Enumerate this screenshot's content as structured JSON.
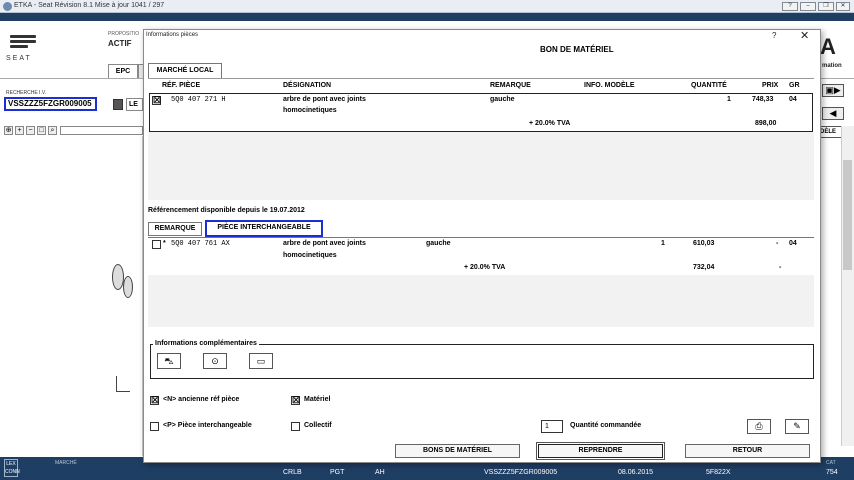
{
  "window": {
    "title": "ETKA - Seat Révision 8.1 Mise à jour 1041 / 297"
  },
  "app": {
    "brand": "SEAT",
    "proposition_label": "PROPOSITIO",
    "status_label": "ACTIF",
    "tab_epc": "EPC",
    "tab_le": "LE",
    "search_label": "RECHERCHE I.V.",
    "vin_value": "VSSZZZ5FZGR009005",
    "right_label_a": "A",
    "right_label_mation": "mation",
    "right_label_dele": "DÈLE"
  },
  "statusbar": {
    "lex_label": "LEX CONN",
    "marche_label": "MARCHÉ",
    "engine": "CRLB",
    "gear": "PGT",
    "ah": "AH",
    "vin": "VSSZZZ5FZGR009005",
    "date": "08.06.2015",
    "code": "5F822X",
    "cat_label": "CAT",
    "cat_value": "754"
  },
  "dialog": {
    "title": "Informations pièces",
    "help": "?",
    "close": "✕",
    "heading": "BON DE MATÉRIEL",
    "market_tab": "MARCHÉ LOCAL",
    "columns": {
      "ref": "RÉF. PIÈCE",
      "designation": "DÉSIGNATION",
      "remark": "REMARQUE",
      "model_info": "INFO. MODÈLE",
      "quantity": "QUANTITÉ",
      "price": "PRIX",
      "gr": "GR"
    },
    "main_part": {
      "checked": "☒",
      "ref": "5Q0 407 271 H",
      "designation_1": "arbre de pont avec joints",
      "designation_2": "homocinetiques",
      "remark": "gauche",
      "quantity": "1",
      "price": "748,33",
      "gr": "04",
      "tva_label": "+ 20.0% TVA",
      "price_tva": "898,00"
    },
    "reference_since": "Référencement disponible depuis le 19.07.2012",
    "sub_tabs": {
      "remark": "REMARQUE",
      "interchangeable": "PIÈCE INTERCHANGEABLE"
    },
    "interch_part": {
      "marker": "*",
      "ref": "5Q0 407 761 AX",
      "designation_1": "arbre de pont avec joints",
      "designation_2": "homocinetiques",
      "remark": "gauche",
      "quantity": "1",
      "price": "610,03",
      "dash": "-",
      "gr": "04",
      "tva_label": "+ 20.0% TVA",
      "price_tva": "732,04",
      "dash2": "-"
    },
    "info_title": "Informations complémentaires",
    "options": {
      "old_ref": "<N> ancienne réf pièce",
      "material": "Matériel",
      "interch": "<P> Pièce interchangeable",
      "collectif": "Collectif",
      "qty_value": "1",
      "qty_label": "Quantité commandée"
    },
    "buttons": {
      "bons": "BONS DE MATÉRIEL",
      "reprendre": "REPRENDRE",
      "retour": "RETOUR"
    }
  },
  "colors": {
    "highlight": "#1a2fd0",
    "navy": "#1f3e63"
  }
}
